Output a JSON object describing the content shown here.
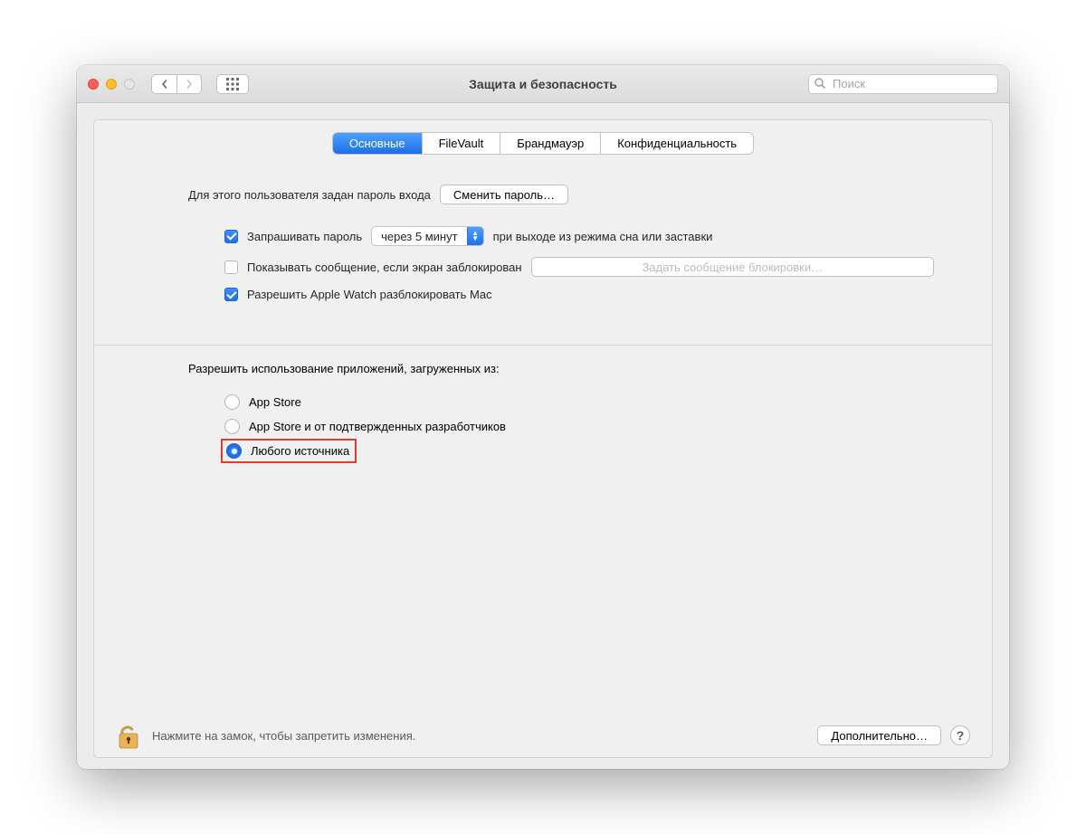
{
  "window": {
    "title": "Защита и безопасность"
  },
  "search": {
    "placeholder": "Поиск"
  },
  "tabs": [
    {
      "label": "Основные",
      "active": true
    },
    {
      "label": "FileVault",
      "active": false
    },
    {
      "label": "Брандмауэр",
      "active": false
    },
    {
      "label": "Конфиденциальность",
      "active": false
    }
  ],
  "password_section": {
    "login_pw_label": "Для этого пользователя задан пароль входа",
    "change_pw_btn": "Сменить пароль…",
    "require_pw_checkbox": "Запрашивать пароль",
    "require_pw_dropdown": "через 5 минут",
    "require_pw_after": "при выходе из режима сна или заставки",
    "show_msg_checkbox": "Показывать сообщение, если экран заблокирован",
    "set_lock_msg_placeholder": "Задать сообщение блокировки…",
    "apple_watch_checkbox": "Разрешить Apple Watch разблокировать Mac"
  },
  "apps_section": {
    "heading": "Разрешить использование приложений, загруженных из:",
    "options": [
      {
        "label": "App Store",
        "selected": false
      },
      {
        "label": "App Store и от подтвержденных разработчиков",
        "selected": false
      },
      {
        "label": "Любого источника",
        "selected": true,
        "highlighted": true
      }
    ]
  },
  "footer": {
    "lock_text": "Нажмите на замок, чтобы запретить изменения.",
    "advanced_btn": "Дополнительно…",
    "help": "?"
  }
}
